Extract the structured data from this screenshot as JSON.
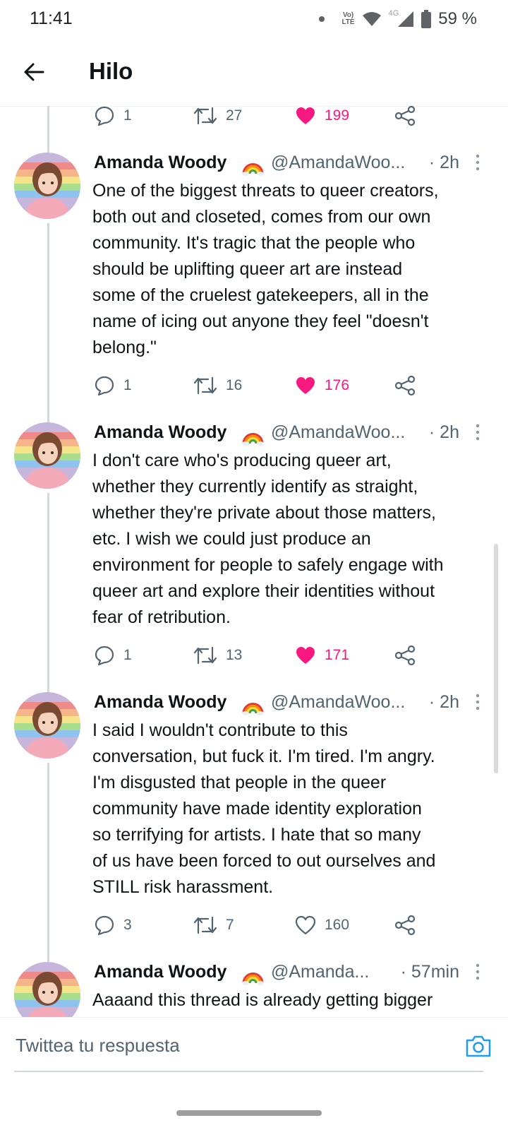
{
  "status_bar": {
    "time": "11:41",
    "volte_top": "Vo)",
    "volte_bottom": "LTE",
    "network": "4G",
    "battery": "59 %"
  },
  "header": {
    "title": "Hilo"
  },
  "top_actions": {
    "replies": "1",
    "retweets": "27",
    "likes": "199",
    "liked": true
  },
  "tweets": [
    {
      "author": "Amanda Woody",
      "handle": "@AmandaWoo...",
      "time": "· 2h",
      "text": "One of the biggest threats to queer creators,\nboth out and closeted, comes from our own\ncommunity. It's tragic that the people who\nshould be uplifting queer art are instead\nsome of the cruelest gatekeepers, all in the\nname of icing out anyone they feel \"doesn't\nbelong.\"",
      "replies": "1",
      "retweets": "16",
      "likes": "176",
      "liked": true
    },
    {
      "author": "Amanda Woody",
      "handle": "@AmandaWoo...",
      "time": "· 2h",
      "text": "I don't care who's producing queer art,\nwhether they currently identify as straight,\nwhether they're private about those matters,\netc. I wish we could just produce an\nenvironment for people to safely engage with\nqueer art and explore their identities without\nfear of retribution.",
      "replies": "1",
      "retweets": "13",
      "likes": "171",
      "liked": true
    },
    {
      "author": "Amanda Woody",
      "handle": "@AmandaWoo...",
      "time": "· 2h",
      "text": "I said I wouldn't contribute to this\nconversation, but fuck it. I'm tired. I'm angry.\nI'm disgusted that people in the queer\ncommunity have made identity exploration\nso terrifying for artists. I hate that so many\nof us have been forced to out ourselves and\nSTILL risk harassment.",
      "replies": "3",
      "retweets": "7",
      "likes": "160",
      "liked": false
    },
    {
      "author": "Amanda Woody",
      "handle": "@Amanda...",
      "time": "· 57min",
      "text": "Aaaand this thread is already getting bigger"
    }
  ],
  "reply_bar": {
    "placeholder": "Twittea tu respuesta"
  },
  "colors": {
    "like": "#f91880",
    "accent": "#1d9bf0",
    "muted": "#536471"
  }
}
